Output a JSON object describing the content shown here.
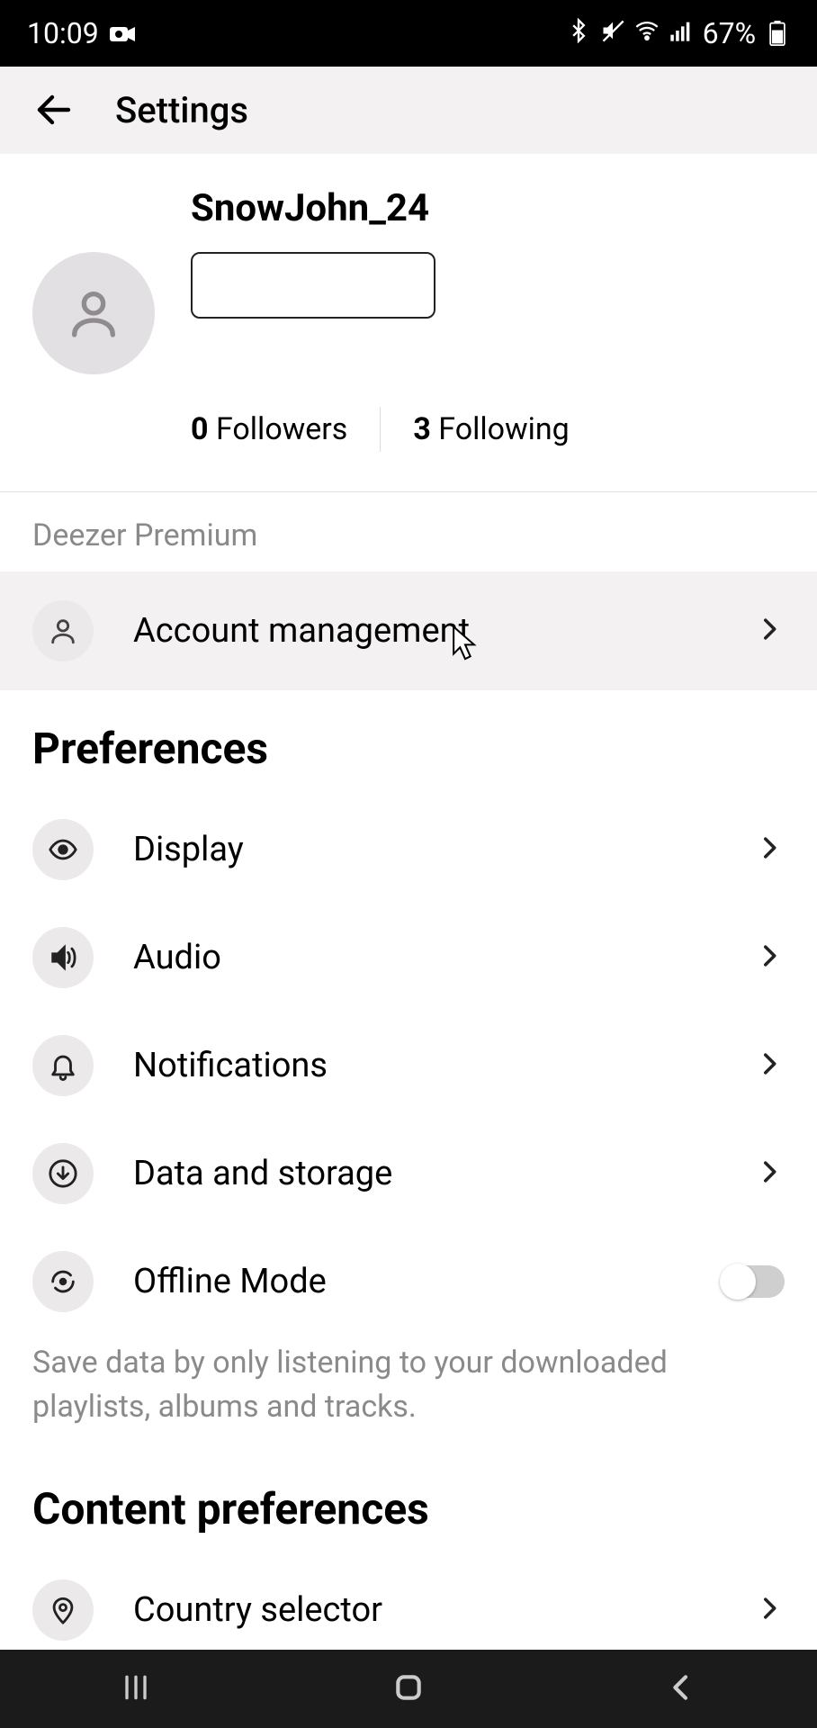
{
  "status": {
    "time": "10:09",
    "battery": "67%"
  },
  "appbar": {
    "title": "Settings"
  },
  "profile": {
    "username": "SnowJohn_24",
    "followers_count": "0",
    "followers_label": " Followers",
    "following_count": "3",
    "following_label": " Following"
  },
  "plan_label": "Deezer Premium",
  "account_row": "Account management",
  "sections": {
    "preferences_title": "Preferences",
    "display": "Display",
    "audio": "Audio",
    "notifications": "Notifications",
    "data_storage": "Data and storage",
    "offline_mode": "Offline Mode",
    "offline_desc": "Save data by only listening to your downloaded playlists, albums and tracks.",
    "content_pref_title": "Content preferences",
    "country_selector": "Country selector"
  }
}
